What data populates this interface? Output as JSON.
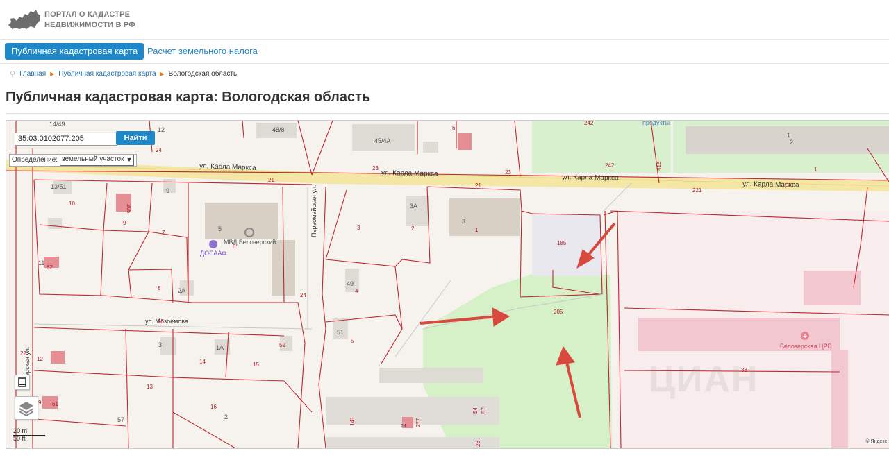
{
  "header": {
    "logo_line1": "ПОРТАЛ О КАДАСТРЕ",
    "logo_line2": "НЕДВИЖИМОСТИ В РФ"
  },
  "nav": {
    "tab_active": "Публичная кадастровая карта",
    "tab_link": "Расчет земельного налога"
  },
  "breadcrumbs": [
    "Главная",
    "Публичная кадастровая карта",
    "Вологодская область"
  ],
  "page_title": "Публичная кадастровая карта: Вологодская область",
  "map": {
    "search_value": "35:03:0102077:205",
    "search_button": "Найти",
    "definition_label": "Определение:",
    "definition_value": "земельный участок",
    "scale_m": "20 m",
    "scale_ft": "50 ft",
    "copyright": "© Яндекс",
    "watermark": "ЦИАН",
    "streets": {
      "marx1": "ул. Карла Маркса",
      "marx2": "ул. Карла Маркса",
      "marx3": "ул. Карла Маркса",
      "marx4": "ул. Карла Маркса",
      "pervomayskaya": "Первомайская ул.",
      "mozemova": "ул. Мозоемова",
      "left": "омерская ул."
    },
    "poi": {
      "mvd": "МВД Белозерский",
      "dosaaf": "ДОСААФ",
      "crb": "Белозерская ЦРБ",
      "products": "продукты"
    },
    "labels": {
      "l1449": "14/49",
      "l12": "12",
      "l488": "48/8",
      "l454a": "45/4A",
      "l6": "6",
      "l242a": "242",
      "l1": "1",
      "l2": "2",
      "l24": "24",
      "l23a": "23",
      "l23b": "23",
      "l242b": "242",
      "l416": "416",
      "l1b": "1",
      "l21a": "21",
      "l21b": "21",
      "l221": "221",
      "l17": "17",
      "l1351": "13/51",
      "l9": "9",
      "l10": "10",
      "l205a": "205",
      "l5": "5",
      "l3a": "3А",
      "l3": "3",
      "l2b": "2",
      "l3b": "3",
      "l1c": "1",
      "l185": "185",
      "l9b": "9",
      "l7": "7",
      "l6b": "6",
      "l11": "11",
      "l62": "62",
      "l8": "8",
      "l2a": "2А",
      "l49": "49",
      "l4": "4",
      "l24b": "24",
      "l205": "205",
      "l25": "25",
      "l51": "51",
      "l5b": "5",
      "l3c": "3",
      "l1a": "1А",
      "l52": "52",
      "l22": "22",
      "l12b": "12",
      "l14": "14",
      "l15": "15",
      "l38": "38",
      "l13": "13",
      "l16": "16",
      "l2c": "2",
      "l57": "57",
      "l9c": "9",
      "l61": "61",
      "l141": "141",
      "l277": "277",
      "l54": "54",
      "l57b": "57",
      "l26": "26",
      "l24c": "24"
    }
  }
}
